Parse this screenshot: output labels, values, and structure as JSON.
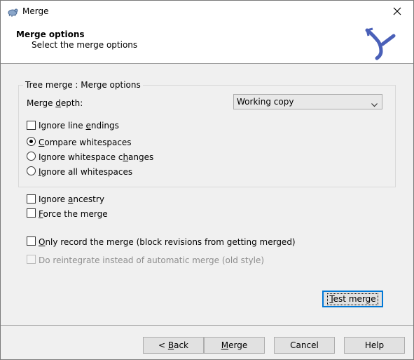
{
  "window": {
    "title": "Merge"
  },
  "header": {
    "title": "Merge options",
    "subtitle": "Select the merge options"
  },
  "group": {
    "legend": "Tree merge : Merge options",
    "merge_depth_label_a": "Merge ",
    "merge_depth_label_u": "d",
    "merge_depth_label_b": "epth:",
    "merge_depth_value": "Working copy",
    "ignore_line_endings": {
      "a": "Ignore line ",
      "u": "e",
      "b": "ndings",
      "checked": false
    },
    "whitespace_options": [
      {
        "a": "",
        "u": "C",
        "b": "ompare whitespaces",
        "selected": true
      },
      {
        "a": "Ignore whitespace c",
        "u": "h",
        "b": "anges",
        "selected": false
      },
      {
        "a": "",
        "u": "I",
        "b": "gnore all whitespaces",
        "selected": false
      }
    ]
  },
  "options": {
    "ignore_ancestry": {
      "a": "Ignore ",
      "u": "a",
      "b": "ncestry",
      "checked": false
    },
    "force_merge": {
      "a": "",
      "u": "F",
      "b": "orce the merge",
      "checked": false
    },
    "only_record": {
      "a": "",
      "u": "O",
      "b": "nly record the merge (block revisions from getting merged)",
      "checked": false
    },
    "reintegrate": {
      "label": "Do reintegrate instead of automatic merge (old style)",
      "checked": false,
      "disabled": true
    }
  },
  "buttons": {
    "test_merge": {
      "u": "T",
      "b": "est merge"
    },
    "back": {
      "a": "< ",
      "u": "B",
      "b": "ack"
    },
    "merge": {
      "u": "M",
      "b": "erge"
    },
    "cancel": "Cancel",
    "help": "Help"
  },
  "colors": {
    "logo": "#4a60b8",
    "default_button_border": "#0078d7"
  },
  "icons": {
    "app": "tortoise-icon",
    "close": "close-icon",
    "logo": "svn-merge-logo",
    "dropdown": "chevron-down-icon"
  }
}
